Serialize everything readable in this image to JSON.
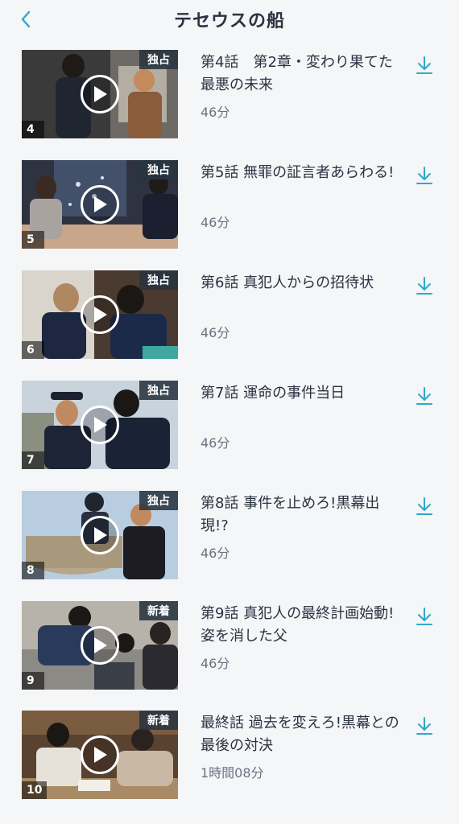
{
  "header": {
    "title": "テセウスの船"
  },
  "colors": {
    "accent": "#2fa8c8",
    "badge_bg": "#283440"
  },
  "episodes": [
    {
      "num": "4",
      "badge": "独占",
      "title": "第4話　第2章・変わり果てた最悪の未来",
      "duration": "46分"
    },
    {
      "num": "5",
      "badge": "独占",
      "title": "第5話 無罪の証言者あらわる!",
      "duration": "46分"
    },
    {
      "num": "6",
      "badge": "独占",
      "title": "第6話 真犯人からの招待状",
      "duration": "46分"
    },
    {
      "num": "7",
      "badge": "独占",
      "title": "第7話 運命の事件当日",
      "duration": "46分"
    },
    {
      "num": "8",
      "badge": "独占",
      "title": "第8話 事件を止めろ!黒幕出現!?",
      "duration": "46分"
    },
    {
      "num": "9",
      "badge": "新着",
      "title": "第9話 真犯人の最終計画始動!姿を消した父",
      "duration": "46分"
    },
    {
      "num": "10",
      "badge": "新着",
      "title": "最終話 過去を変えろ!黒幕との最後の対決",
      "duration": "1時間08分"
    }
  ]
}
